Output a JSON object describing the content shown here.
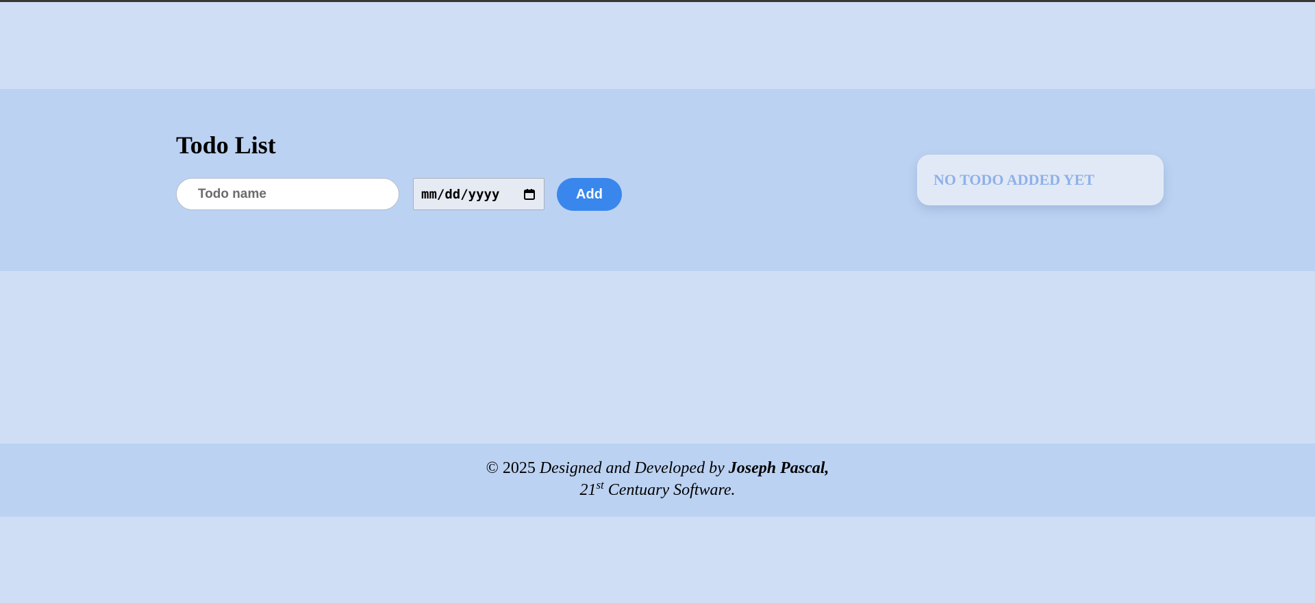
{
  "header": {
    "title": "Todo List"
  },
  "form": {
    "todo_placeholder": "Todo name",
    "date_placeholder": "mm/dd/yyyy",
    "add_label": "Add"
  },
  "todo_list": {
    "empty_message": "NO TODO ADDED YET"
  },
  "footer": {
    "copyright": "© 2025",
    "designed_by": "Designed and Developed by",
    "author": "Joseph Pascal,",
    "ordinal_number": "21",
    "ordinal_suffix": "st",
    "company": "Centuary Software."
  },
  "icons": {
    "date_picker": "calendar-icon"
  },
  "colors": {
    "background": "#cfdef5",
    "band": "#bcd2f2",
    "accent": "#3987ec",
    "empty_text": "#8eb1e8",
    "card": "#e2e9f6"
  }
}
